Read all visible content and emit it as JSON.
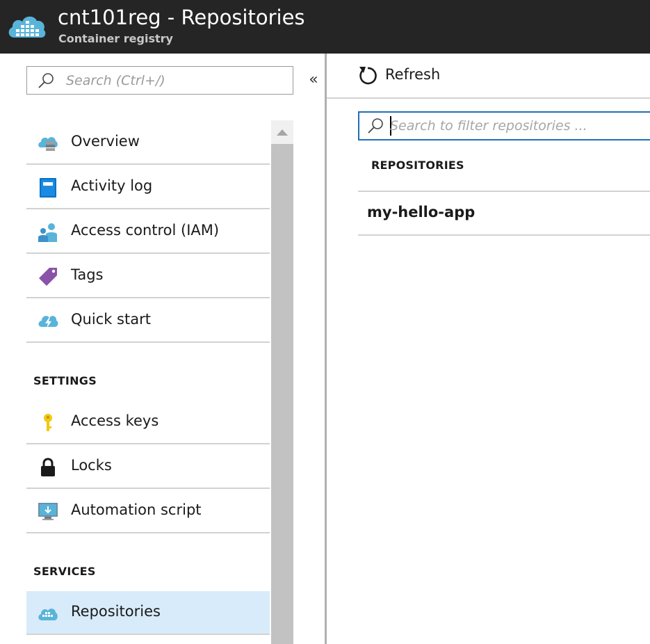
{
  "header": {
    "title": "cnt101reg - Repositories",
    "subtitle": "Container registry",
    "logo_icon": "container-registry-cloud-icon"
  },
  "left": {
    "search": {
      "placeholder": "Search (Ctrl+/)",
      "value": ""
    },
    "collapse_glyph": "«",
    "sections": [
      {
        "heading": "",
        "items": [
          {
            "label": "Overview",
            "icon": "overview-icon"
          },
          {
            "label": "Activity log",
            "icon": "activity-log-icon"
          },
          {
            "label": "Access control (IAM)",
            "icon": "access-control-icon"
          },
          {
            "label": "Tags",
            "icon": "tag-icon"
          },
          {
            "label": "Quick start",
            "icon": "quick-start-icon"
          }
        ]
      },
      {
        "heading": "SETTINGS",
        "items": [
          {
            "label": "Access keys",
            "icon": "key-icon"
          },
          {
            "label": "Locks",
            "icon": "lock-icon"
          },
          {
            "label": "Automation script",
            "icon": "automation-script-icon"
          }
        ]
      },
      {
        "heading": "SERVICES",
        "items": [
          {
            "label": "Repositories",
            "icon": "repositories-icon",
            "selected": true
          }
        ]
      }
    ]
  },
  "right": {
    "refresh_label": "Refresh",
    "filter": {
      "placeholder": "Search to filter repositories ...",
      "value": ""
    },
    "table_header": "REPOSITORIES",
    "repositories": [
      "my-hello-app"
    ]
  },
  "colors": {
    "header_bg": "#252525",
    "accent_blue": "#1f6fb8",
    "selected_bg": "#d8ebfa",
    "azure_blue": "#59b4d9"
  }
}
